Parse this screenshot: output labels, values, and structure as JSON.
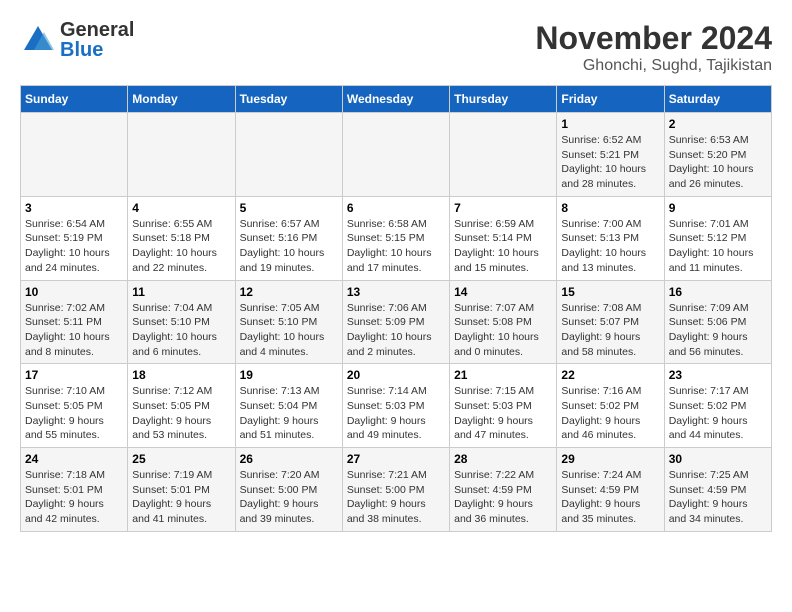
{
  "header": {
    "logo_general": "General",
    "logo_blue": "Blue",
    "title": "November 2024",
    "subtitle": "Ghonchi, Sughd, Tajikistan"
  },
  "days_of_week": [
    "Sunday",
    "Monday",
    "Tuesday",
    "Wednesday",
    "Thursday",
    "Friday",
    "Saturday"
  ],
  "weeks": [
    [
      {
        "day": "",
        "info": ""
      },
      {
        "day": "",
        "info": ""
      },
      {
        "day": "",
        "info": ""
      },
      {
        "day": "",
        "info": ""
      },
      {
        "day": "",
        "info": ""
      },
      {
        "day": "1",
        "info": "Sunrise: 6:52 AM\nSunset: 5:21 PM\nDaylight: 10 hours and 28 minutes."
      },
      {
        "day": "2",
        "info": "Sunrise: 6:53 AM\nSunset: 5:20 PM\nDaylight: 10 hours and 26 minutes."
      }
    ],
    [
      {
        "day": "3",
        "info": "Sunrise: 6:54 AM\nSunset: 5:19 PM\nDaylight: 10 hours and 24 minutes."
      },
      {
        "day": "4",
        "info": "Sunrise: 6:55 AM\nSunset: 5:18 PM\nDaylight: 10 hours and 22 minutes."
      },
      {
        "day": "5",
        "info": "Sunrise: 6:57 AM\nSunset: 5:16 PM\nDaylight: 10 hours and 19 minutes."
      },
      {
        "day": "6",
        "info": "Sunrise: 6:58 AM\nSunset: 5:15 PM\nDaylight: 10 hours and 17 minutes."
      },
      {
        "day": "7",
        "info": "Sunrise: 6:59 AM\nSunset: 5:14 PM\nDaylight: 10 hours and 15 minutes."
      },
      {
        "day": "8",
        "info": "Sunrise: 7:00 AM\nSunset: 5:13 PM\nDaylight: 10 hours and 13 minutes."
      },
      {
        "day": "9",
        "info": "Sunrise: 7:01 AM\nSunset: 5:12 PM\nDaylight: 10 hours and 11 minutes."
      }
    ],
    [
      {
        "day": "10",
        "info": "Sunrise: 7:02 AM\nSunset: 5:11 PM\nDaylight: 10 hours and 8 minutes."
      },
      {
        "day": "11",
        "info": "Sunrise: 7:04 AM\nSunset: 5:10 PM\nDaylight: 10 hours and 6 minutes."
      },
      {
        "day": "12",
        "info": "Sunrise: 7:05 AM\nSunset: 5:10 PM\nDaylight: 10 hours and 4 minutes."
      },
      {
        "day": "13",
        "info": "Sunrise: 7:06 AM\nSunset: 5:09 PM\nDaylight: 10 hours and 2 minutes."
      },
      {
        "day": "14",
        "info": "Sunrise: 7:07 AM\nSunset: 5:08 PM\nDaylight: 10 hours and 0 minutes."
      },
      {
        "day": "15",
        "info": "Sunrise: 7:08 AM\nSunset: 5:07 PM\nDaylight: 9 hours and 58 minutes."
      },
      {
        "day": "16",
        "info": "Sunrise: 7:09 AM\nSunset: 5:06 PM\nDaylight: 9 hours and 56 minutes."
      }
    ],
    [
      {
        "day": "17",
        "info": "Sunrise: 7:10 AM\nSunset: 5:05 PM\nDaylight: 9 hours and 55 minutes."
      },
      {
        "day": "18",
        "info": "Sunrise: 7:12 AM\nSunset: 5:05 PM\nDaylight: 9 hours and 53 minutes."
      },
      {
        "day": "19",
        "info": "Sunrise: 7:13 AM\nSunset: 5:04 PM\nDaylight: 9 hours and 51 minutes."
      },
      {
        "day": "20",
        "info": "Sunrise: 7:14 AM\nSunset: 5:03 PM\nDaylight: 9 hours and 49 minutes."
      },
      {
        "day": "21",
        "info": "Sunrise: 7:15 AM\nSunset: 5:03 PM\nDaylight: 9 hours and 47 minutes."
      },
      {
        "day": "22",
        "info": "Sunrise: 7:16 AM\nSunset: 5:02 PM\nDaylight: 9 hours and 46 minutes."
      },
      {
        "day": "23",
        "info": "Sunrise: 7:17 AM\nSunset: 5:02 PM\nDaylight: 9 hours and 44 minutes."
      }
    ],
    [
      {
        "day": "24",
        "info": "Sunrise: 7:18 AM\nSunset: 5:01 PM\nDaylight: 9 hours and 42 minutes."
      },
      {
        "day": "25",
        "info": "Sunrise: 7:19 AM\nSunset: 5:01 PM\nDaylight: 9 hours and 41 minutes."
      },
      {
        "day": "26",
        "info": "Sunrise: 7:20 AM\nSunset: 5:00 PM\nDaylight: 9 hours and 39 minutes."
      },
      {
        "day": "27",
        "info": "Sunrise: 7:21 AM\nSunset: 5:00 PM\nDaylight: 9 hours and 38 minutes."
      },
      {
        "day": "28",
        "info": "Sunrise: 7:22 AM\nSunset: 4:59 PM\nDaylight: 9 hours and 36 minutes."
      },
      {
        "day": "29",
        "info": "Sunrise: 7:24 AM\nSunset: 4:59 PM\nDaylight: 9 hours and 35 minutes."
      },
      {
        "day": "30",
        "info": "Sunrise: 7:25 AM\nSunset: 4:59 PM\nDaylight: 9 hours and 34 minutes."
      }
    ]
  ]
}
